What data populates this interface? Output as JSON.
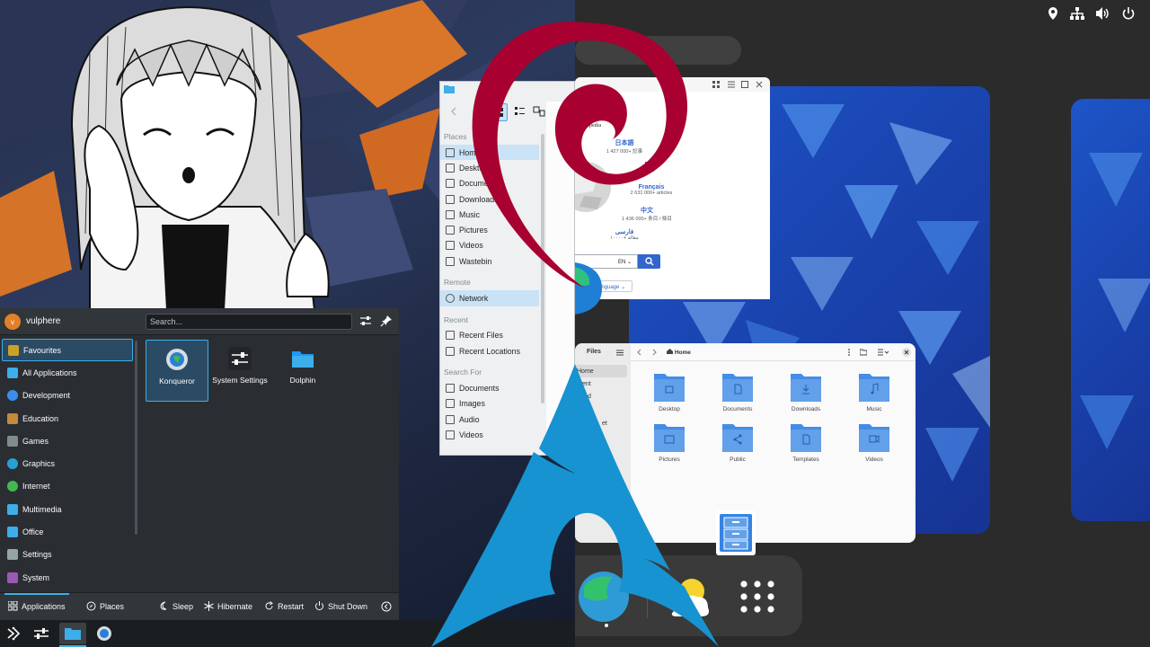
{
  "launcher": {
    "user": "vulphere",
    "avatar_initial": "v",
    "search_placeholder": "Search...",
    "categories": [
      {
        "label": "Favourites",
        "icon": "star-icon",
        "color": "#c9a227"
      },
      {
        "label": "All Applications",
        "icon": "grid-icon",
        "color": "#3daee9"
      },
      {
        "label": "Development",
        "icon": "code-icon",
        "color": "#3d8ee9"
      },
      {
        "label": "Education",
        "icon": "education-icon",
        "color": "#c48a3a"
      },
      {
        "label": "Games",
        "icon": "gamepad-icon",
        "color": "#7f8c8d"
      },
      {
        "label": "Graphics",
        "icon": "graphics-icon",
        "color": "#2a9fd6"
      },
      {
        "label": "Internet",
        "icon": "globe-icon",
        "color": "#3fb950"
      },
      {
        "label": "Multimedia",
        "icon": "multimedia-icon",
        "color": "#3daee9"
      },
      {
        "label": "Office",
        "icon": "office-icon",
        "color": "#3daee9"
      },
      {
        "label": "Settings",
        "icon": "settings-icon",
        "color": "#95a5a6"
      },
      {
        "label": "System",
        "icon": "system-icon",
        "color": "#9b59b6"
      }
    ],
    "apps": [
      {
        "label": "Konqueror"
      },
      {
        "label": "System Settings"
      },
      {
        "label": "Dolphin"
      }
    ],
    "footer": {
      "applications": "Applications",
      "places": "Places",
      "sleep": "Sleep",
      "hibernate": "Hibernate",
      "restart": "Restart",
      "shutdown": "Shut Down"
    }
  },
  "dolphin": {
    "places_header": "Places",
    "places": [
      "Home",
      "Desktop",
      "Documents",
      "Downloads",
      "Music",
      "Pictures",
      "Videos",
      "Wastebin"
    ],
    "remote_header": "Remote",
    "remote": [
      "Network"
    ],
    "recent_header": "Recent",
    "recent": [
      "Recent Files",
      "Recent Locations"
    ],
    "search_header": "Search For",
    "search": [
      "Documents",
      "Images",
      "Audio",
      "Videos"
    ]
  },
  "wiki": {
    "logo_text": "PEDIA",
    "tagline": "ncyclopedia",
    "languages": [
      {
        "name": "日本語",
        "count": "1 427 000+ 記事"
      },
      {
        "name": "En",
        "count": "ticles"
      },
      {
        "name": "Français",
        "count": "2 631 000+ articles"
      },
      {
        "name": "中文",
        "count": "1 436 000+ 条目 / 條目"
      },
      {
        "name": "فارسی",
        "count": "۱۰۰۰۰+ مقاله"
      }
    ],
    "search_lang": "EN",
    "lang_button": "anguage"
  },
  "files": {
    "sidebar_title": "Files",
    "sidebar_items": [
      "Home",
      "ent",
      "d",
      "",
      "et"
    ],
    "path": "Home",
    "folders": [
      "Desktop",
      "Documents",
      "Downloads",
      "Music",
      "Pictures",
      "Public",
      "Templates",
      "Videos"
    ]
  },
  "colors": {
    "kde_accent": "#3daee9",
    "gnome_blue": "#3584e4",
    "debian_red": "#a80030",
    "arch_blue": "#1793d1"
  }
}
